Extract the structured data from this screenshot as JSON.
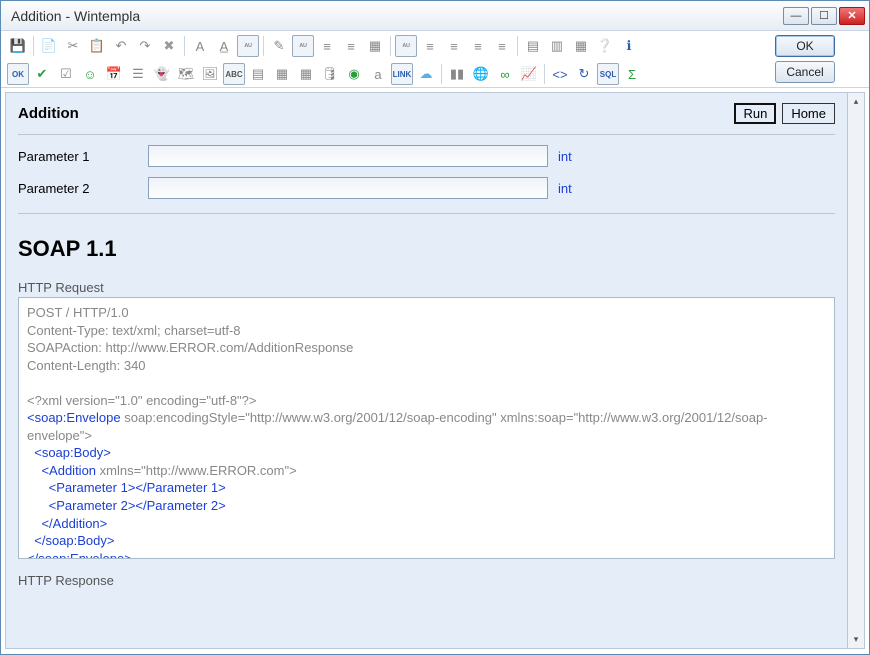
{
  "window": {
    "title": "Addition   -   Wintempla"
  },
  "buttons": {
    "ok": "OK",
    "cancel": "Cancel",
    "run": "Run",
    "home": "Home"
  },
  "page": {
    "heading": "Addition",
    "soap_heading": "SOAP 1.1",
    "http_request_label": "HTTP Request",
    "http_response_label": "HTTP Response"
  },
  "params": [
    {
      "label": "Parameter 1",
      "type": "int",
      "value": ""
    },
    {
      "label": "Parameter 2",
      "type": "int",
      "value": ""
    }
  ],
  "http_request": {
    "line1": "POST / HTTP/1.0",
    "line2": "Content-Type: text/xml; charset=utf-8",
    "line3": "SOAPAction: http://www.ERROR.com/AdditionResponse",
    "line4": "Content-Length: 340",
    "xml_decl": "<?xml version=\"1.0\" encoding=\"utf-8\"?>",
    "env_open_a": "<",
    "env_open_b": "soap:Envelope",
    "env_open_c": " soap:encodingStyle=\"http://www.w3.org/2001/12/soap-encoding\" xmlns:soap=\"http://www.w3.org/2001/12/soap-envelope\">",
    "body_open": "soap:Body",
    "addition_open_a": "Addition",
    "addition_open_b": " xmlns=\"http://www.ERROR.com\">",
    "p1": "Parameter 1",
    "p2": "Parameter 2",
    "addition_close": "Addition",
    "body_close": "soap:Body",
    "env_close": "soap:Envelope"
  },
  "toolbar_icons": [
    "save-icon",
    "sep",
    "copy-icon",
    "cut-icon",
    "paste-icon",
    "undo-icon",
    "redo-icon",
    "delete-icon",
    "sep",
    "font-bold-icon",
    "font-underline-icon",
    "auto-icon",
    "sep",
    "paint-icon",
    "auto2-icon",
    "align-left-group-icon",
    "align-center-group-icon",
    "select-all-icon",
    "sep",
    "auto3-icon",
    "align-left-icon",
    "align-center-icon",
    "align-right-icon",
    "align-justify-icon",
    "sep",
    "grid1-icon",
    "grid2-icon",
    "grid3-icon",
    "help-icon",
    "info-icon",
    "br",
    "ok-badge-icon",
    "check-icon",
    "list-check-icon",
    "smiley-icon",
    "calendar-icon",
    "doc-lines-icon",
    "ghost-icon",
    "map-icon",
    "image-icon",
    "abc-icon",
    "page-icon",
    "table-icon",
    "table-add-icon",
    "db-icon",
    "record-icon",
    "text-a-icon",
    "link-icon",
    "cloud-icon",
    "sep2",
    "chart-bar-icon",
    "globe-icon",
    "infinity-icon",
    "chart-line-icon",
    "sep2",
    "code-icon",
    "refresh-icon",
    "sql-icon",
    "sigma-icon"
  ]
}
